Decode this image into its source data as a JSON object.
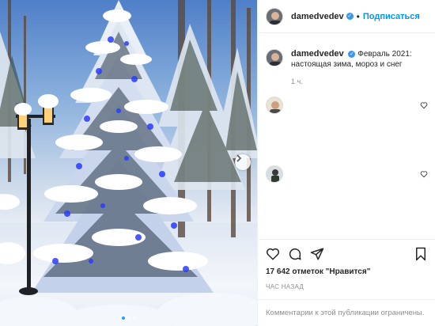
{
  "post": {
    "author": "damedvedev",
    "follow_label": "Подписаться",
    "separator": "•",
    "caption_user": "damedvedev",
    "caption_text": "Февраль 2021: настоящая зима, мороз и снег",
    "caption_time": "1 ч.",
    "likes_text": "17 642 отметок \"Нравится\"",
    "time_ago": "ЧАС НАЗАД",
    "comments_limited": "Комментарии к этой публикации ограничены.",
    "carousel_count": 3,
    "carousel_active": 1
  },
  "colors": {
    "accent": "#0095f6",
    "verified": "#3897f0",
    "muted": "#8e8e8e",
    "text": "#262626"
  },
  "icons": [
    "next-arrow-icon",
    "heart-icon",
    "comment-icon",
    "share-icon",
    "bookmark-icon",
    "verified-icon"
  ]
}
